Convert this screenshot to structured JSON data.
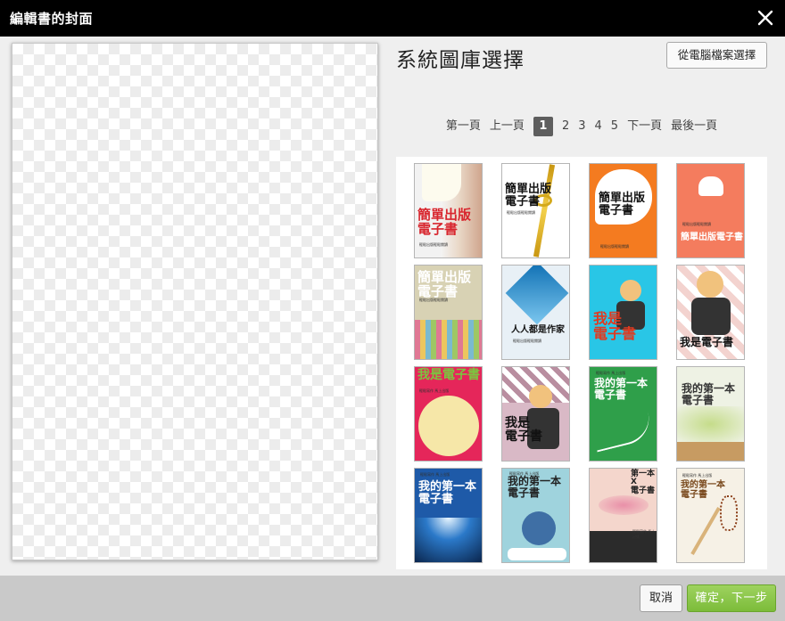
{
  "dialog": {
    "title": "編輯書的封面",
    "close_icon": "close-icon"
  },
  "panel": {
    "title": "系統圖庫選擇",
    "upload_button": "從電腦檔案選擇"
  },
  "pagination": {
    "first": "第一頁",
    "prev": "上一頁",
    "pages": [
      "1",
      "2",
      "3",
      "4",
      "5"
    ],
    "current": "1",
    "next": "下一頁",
    "last": "最後一頁"
  },
  "covers": [
    {
      "title": "簡單出版\n電子書",
      "subtitle": "輕鬆出版輕鬆閱讀",
      "colors": {
        "bg": "#f2f2f2",
        "title": "#d8262e"
      }
    },
    {
      "title": "簡單出版\n電子書",
      "subtitle": "輕鬆出版輕鬆閱讀",
      "colors": {
        "bg": "#ffffff",
        "title": "#111111"
      }
    },
    {
      "title": "簡單出版\n電子書",
      "subtitle": "輕鬆出版輕鬆閱讀",
      "colors": {
        "bg": "#f47b20",
        "title": "#111111"
      }
    },
    {
      "title": "簡單出版電子書",
      "subtitle": "輕鬆出版輕鬆閱讀",
      "colors": {
        "bg": "#f47c5e",
        "title": "#ffffff"
      }
    },
    {
      "title": "簡單出版\n電子書",
      "subtitle": "輕鬆出版輕鬆閱讀",
      "colors": {
        "bg": "#d8d2b4",
        "title": "#ffffff"
      }
    },
    {
      "title": "人人都是作家",
      "subtitle": "輕鬆出版輕鬆閱讀",
      "colors": {
        "bg": "#e8f0f6",
        "title": "#111111"
      }
    },
    {
      "title": "我是\n電子書",
      "subtitle": "",
      "colors": {
        "bg": "#29c6e6",
        "title": "#e03a20"
      }
    },
    {
      "title": "我是電子書",
      "subtitle": "",
      "colors": {
        "bg": "#e8e8e8",
        "title": "#111111"
      }
    },
    {
      "title": "我是電子書",
      "subtitle": "輕鬆寫作 馬上出版",
      "colors": {
        "bg": "#e5265a",
        "title": "#7bc53f"
      }
    },
    {
      "title": "我是\n電子書",
      "subtitle": "",
      "colors": {
        "bg": "#d9b9c6",
        "title": "#111111"
      }
    },
    {
      "title": "我的第一本\n電子書",
      "subtitle": "輕鬆寫作 馬上出版",
      "colors": {
        "bg": "#2f9f4a",
        "title": "#ffffff"
      }
    },
    {
      "title": "我的第一本\n電子書",
      "subtitle": "",
      "colors": {
        "bg": "#eef2e4",
        "title": "#333333"
      }
    },
    {
      "title": "我的第一本\n電子書",
      "subtitle": "輕鬆寫作 馬上出版",
      "colors": {
        "bg": "#1e5aa8",
        "title": "#ffffff"
      }
    },
    {
      "title": "我的第一本\n電子書",
      "subtitle": "輕鬆寫作 馬上出版",
      "colors": {
        "bg": "#9fd3dd",
        "title": "#222222"
      }
    },
    {
      "title": "第一本\nX\n電子書",
      "subtitle": "輕鬆寫作 馬上出版",
      "colors": {
        "bg": "#f4d6cc",
        "title": "#222222"
      }
    },
    {
      "title": "我的第一本\n電子書",
      "subtitle": "輕鬆寫作 馬上出版",
      "colors": {
        "bg": "#f6f1e6",
        "title": "#7a4a1e"
      }
    }
  ],
  "footer": {
    "cancel": "取消",
    "confirm": "確定，下一步"
  }
}
